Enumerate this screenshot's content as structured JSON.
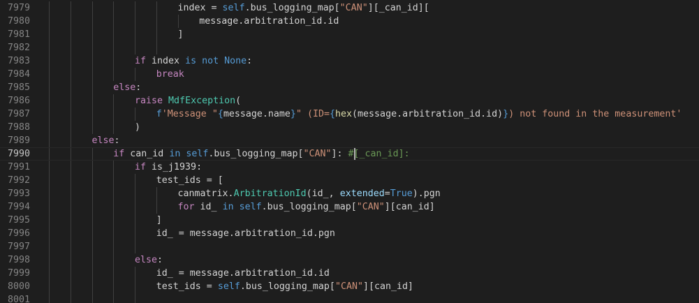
{
  "editor": {
    "language": "python",
    "current_line": "7990",
    "lines": [
      {
        "number": "7979",
        "indent": 6,
        "tokens": [
          [
            "p",
            "index = "
          ],
          [
            "kw2",
            "self"
          ],
          [
            "p",
            ".bus_logging_map["
          ],
          [
            "str",
            "\"CAN\""
          ],
          [
            "p",
            "][_can_id]["
          ]
        ]
      },
      {
        "number": "7980",
        "indent": 7,
        "tokens": [
          [
            "p",
            "message.arbitration_id.id"
          ]
        ]
      },
      {
        "number": "7981",
        "indent": 6,
        "tokens": [
          [
            "p",
            "]"
          ]
        ]
      },
      {
        "number": "7982",
        "indent": 0,
        "tokens": []
      },
      {
        "number": "7983",
        "indent": 4,
        "tokens": [
          [
            "kw",
            "if"
          ],
          [
            "p",
            " index "
          ],
          [
            "kw2",
            "is not"
          ],
          [
            "p",
            " "
          ],
          [
            "kw2",
            "None"
          ],
          [
            "p",
            ":"
          ]
        ]
      },
      {
        "number": "7984",
        "indent": 5,
        "tokens": [
          [
            "kw",
            "break"
          ]
        ]
      },
      {
        "number": "7985",
        "indent": 3,
        "tokens": [
          [
            "kw",
            "else"
          ],
          [
            "p",
            ":"
          ]
        ]
      },
      {
        "number": "7986",
        "indent": 4,
        "tokens": [
          [
            "kw",
            "raise"
          ],
          [
            "p",
            " "
          ],
          [
            "cls",
            "MdfException"
          ],
          [
            "p",
            "("
          ]
        ]
      },
      {
        "number": "7987",
        "indent": 5,
        "tokens": [
          [
            "kw2",
            "f"
          ],
          [
            "str",
            "'Message \""
          ],
          [
            "kw2",
            "{"
          ],
          [
            "p",
            "message.name"
          ],
          [
            "kw2",
            "}"
          ],
          [
            "str",
            "\" (ID="
          ],
          [
            "kw2",
            "{"
          ],
          [
            "fn",
            "hex"
          ],
          [
            "p",
            "(message.arbitration_id.id)"
          ],
          [
            "kw2",
            "}"
          ],
          [
            "str",
            ") not found in the measurement'"
          ]
        ]
      },
      {
        "number": "7988",
        "indent": 4,
        "tokens": [
          [
            "p",
            ")"
          ]
        ]
      },
      {
        "number": "7989",
        "indent": 2,
        "tokens": [
          [
            "kw",
            "else"
          ],
          [
            "p",
            ":"
          ]
        ]
      },
      {
        "number": "7990",
        "indent": 3,
        "tokens": [
          [
            "kw",
            "if"
          ],
          [
            "p",
            " can_id "
          ],
          [
            "kw2",
            "in"
          ],
          [
            "p",
            " "
          ],
          [
            "kw2",
            "self"
          ],
          [
            "p",
            ".bus_logging_map["
          ],
          [
            "str",
            "\"CAN\""
          ],
          [
            "p",
            "]: "
          ],
          [
            "com",
            "#[_can_id]:"
          ]
        ]
      },
      {
        "number": "7991",
        "indent": 4,
        "tokens": [
          [
            "kw",
            "if"
          ],
          [
            "p",
            " is_j1939:"
          ]
        ]
      },
      {
        "number": "7992",
        "indent": 5,
        "tokens": [
          [
            "p",
            "test_ids = ["
          ]
        ]
      },
      {
        "number": "7993",
        "indent": 6,
        "tokens": [
          [
            "p",
            "canmatrix."
          ],
          [
            "cls",
            "ArbitrationId"
          ],
          [
            "p",
            "(id_, "
          ],
          [
            "var",
            "extended"
          ],
          [
            "p",
            "="
          ],
          [
            "kw2",
            "True"
          ],
          [
            "p",
            ").pgn"
          ]
        ]
      },
      {
        "number": "7994",
        "indent": 6,
        "tokens": [
          [
            "kw",
            "for"
          ],
          [
            "p",
            " id_ "
          ],
          [
            "kw2",
            "in"
          ],
          [
            "p",
            " "
          ],
          [
            "kw2",
            "self"
          ],
          [
            "p",
            ".bus_logging_map["
          ],
          [
            "str",
            "\"CAN\""
          ],
          [
            "p",
            "][can_id]"
          ]
        ]
      },
      {
        "number": "7995",
        "indent": 5,
        "tokens": [
          [
            "p",
            "]"
          ]
        ]
      },
      {
        "number": "7996",
        "indent": 5,
        "tokens": [
          [
            "p",
            "id_ = message.arbitration_id.pgn"
          ]
        ]
      },
      {
        "number": "7997",
        "indent": 0,
        "tokens": []
      },
      {
        "number": "7998",
        "indent": 4,
        "tokens": [
          [
            "kw",
            "else"
          ],
          [
            "p",
            ":"
          ]
        ]
      },
      {
        "number": "7999",
        "indent": 5,
        "tokens": [
          [
            "p",
            "id_ = message.arbitration_id.id"
          ]
        ]
      },
      {
        "number": "8000",
        "indent": 5,
        "tokens": [
          [
            "p",
            "test_ids = "
          ],
          [
            "kw2",
            "self"
          ],
          [
            "p",
            ".bus_logging_map["
          ],
          [
            "str",
            "\"CAN\""
          ],
          [
            "p",
            "][can_id]"
          ]
        ]
      },
      {
        "number": "8001",
        "indent": 0,
        "tokens": []
      }
    ]
  }
}
